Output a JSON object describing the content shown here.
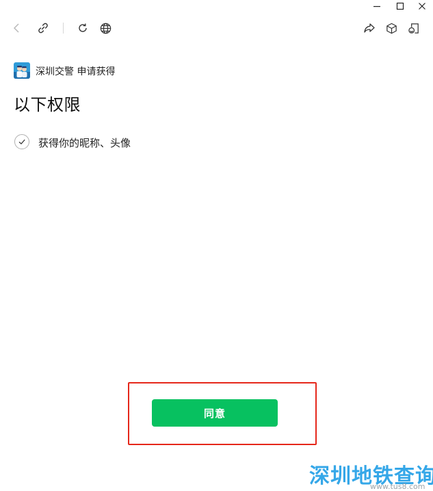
{
  "window": {
    "minimize_icon": "minimize-icon",
    "maximize_icon": "maximize-icon",
    "close_icon": "close-icon"
  },
  "toolbar": {
    "left_icons": [
      "back-icon",
      "link-icon",
      "refresh-icon",
      "globe-icon"
    ],
    "right_icons": [
      "share-icon",
      "cube-icon",
      "mini-program-icon"
    ]
  },
  "auth": {
    "app_name": "深圳交警",
    "request_text": "申请获得",
    "title": "以下权限",
    "permissions": [
      {
        "label": "获得你的昵称、头像",
        "checked": true
      }
    ],
    "agree_button": "同意"
  },
  "watermark": {
    "text": "深圳地铁查询",
    "url": "www.tus8.com"
  },
  "colors": {
    "accent": "#07c160",
    "highlight": "#e5271a",
    "watermark": "#35a7e8"
  }
}
